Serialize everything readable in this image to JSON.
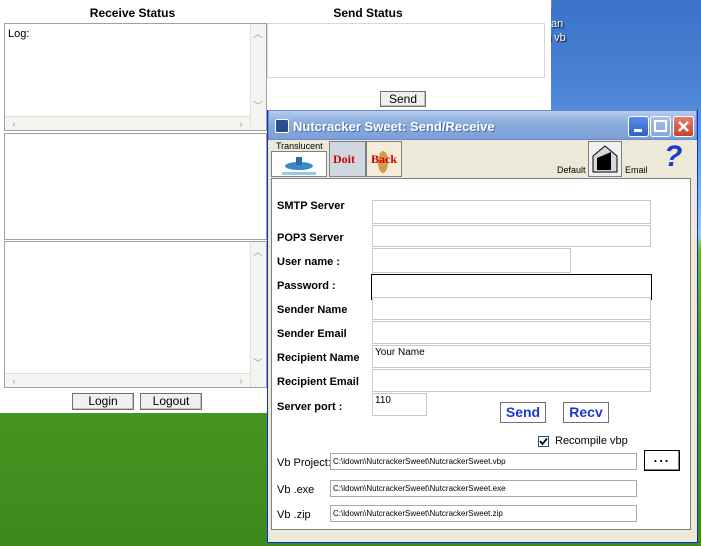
{
  "desktop": {
    "icon_label_1": "an",
    "icon_label_2": "n vb"
  },
  "status_window": {
    "receive_header": "Receive Status",
    "send_header": "Send Status",
    "log_label": "Log:",
    "send_button": "Send",
    "login_button": "Login",
    "logout_button": "Logout"
  },
  "dialog": {
    "title": "Nutcracker Sweet: Send/Receive",
    "toolbar": {
      "translucent_label": "Translucent",
      "doit_label": "Doit",
      "back_label": "Back",
      "default_label": "Default",
      "email_label": "Email",
      "help_glyph": "?"
    },
    "fields": {
      "smtp_label": "SMTP Server",
      "smtp_value": "",
      "pop3_label": "POP3 Server",
      "pop3_value": "",
      "user_label": "User name :",
      "user_value": "",
      "password_label": "Password :",
      "password_value": "",
      "sender_name_label": "Sender Name",
      "sender_name_value": "",
      "sender_email_label": "Sender Email",
      "sender_email_value": "",
      "recipient_name_label": "Recipient Name",
      "recipient_name_value": "Your Name",
      "recipient_email_label": "Recipient Email",
      "recipient_email_value": "",
      "server_port_label": "Server port :",
      "server_port_value": "110"
    },
    "send_button": "Send",
    "recv_button": "Recv",
    "recompile_label": "Recompile vbp",
    "recompile_checked": true,
    "vb_project_label": "Vb Project:",
    "vb_project_value": "C:\\ldown\\NutcrackerSweet\\NutcrackerSweet.vbp",
    "browse_button": "...",
    "vb_exe_label": "Vb .exe",
    "vb_exe_value": "C:\\ldown\\NutcrackerSweet\\NutcrackerSweet.exe",
    "vb_zip_label": "Vb .zip",
    "vb_zip_value": "C:\\ldown\\NutcrackerSweet\\NutcrackerSweet.zip"
  },
  "colors": {
    "title_bar": "#8eadde",
    "button_text": "#1a3acc",
    "desktop_grass": "#4d9a25",
    "desktop_sky": "#4d86d6"
  }
}
